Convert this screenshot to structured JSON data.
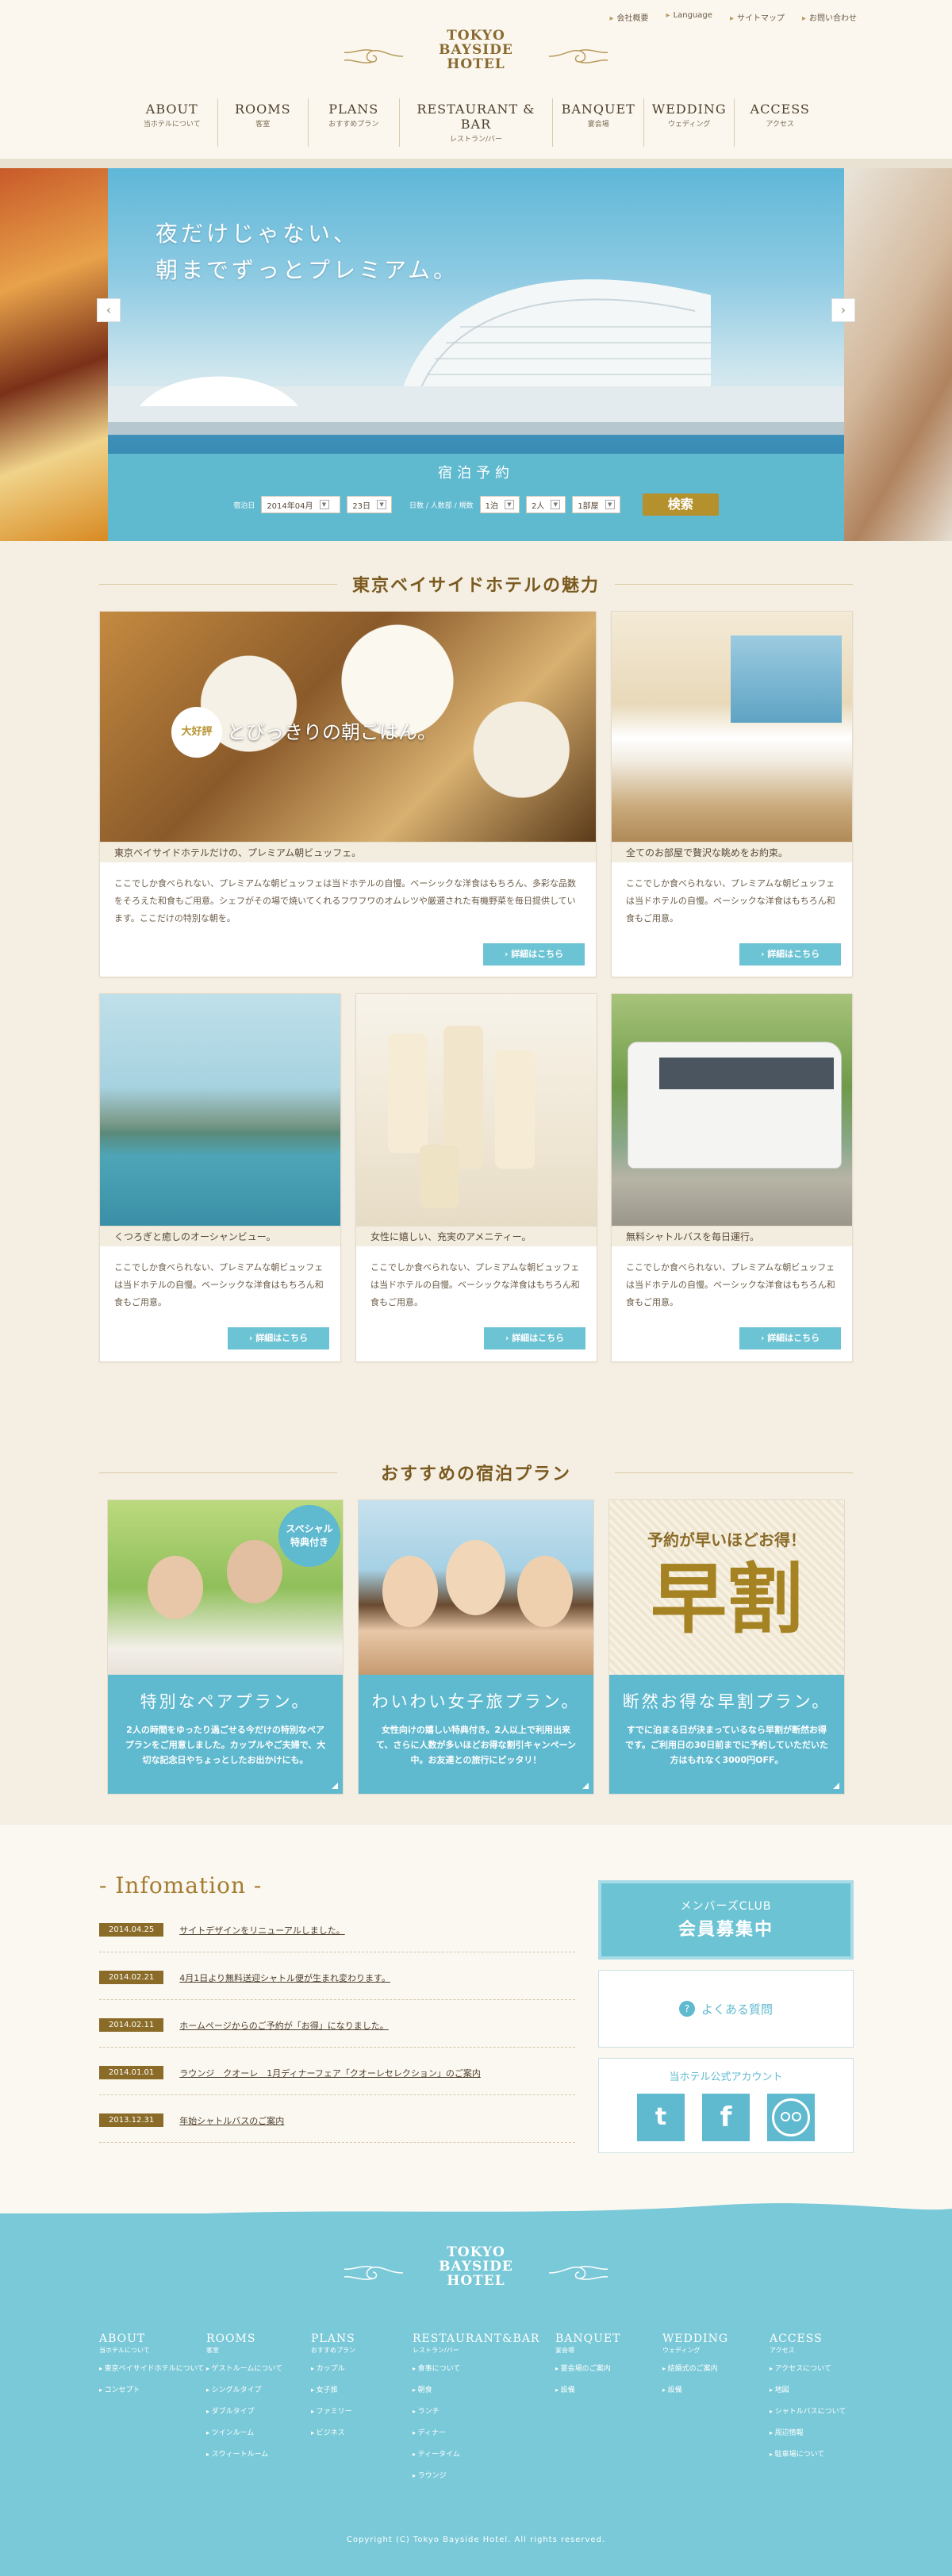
{
  "header": {
    "top_links": [
      "会社概要",
      "Language",
      "サイトマップ",
      "お問い合わせ"
    ],
    "logo_lines": [
      "TOKYO",
      "BAYSIDE",
      "HOTEL"
    ],
    "nav": [
      {
        "en": "ABOUT",
        "ja": "当ホテルについて"
      },
      {
        "en": "ROOMS",
        "ja": "客室"
      },
      {
        "en": "PLANS",
        "ja": "おすすめプラン"
      },
      {
        "en": "RESTAURANT & BAR",
        "ja": "レストラン/バー"
      },
      {
        "en": "BANQUET",
        "ja": "宴会場"
      },
      {
        "en": "WEDDING",
        "ja": "ウェディング"
      },
      {
        "en": "ACCESS",
        "ja": "アクセス"
      }
    ]
  },
  "hero": {
    "copy_line1": "夜だけじゃない、",
    "copy_line2": "朝までずっとプレミアム。",
    "prev_icon": "chevron-left-icon",
    "next_icon": "chevron-right-icon"
  },
  "booking": {
    "title": "宿泊予約",
    "checkin_label": "宿泊日",
    "month_value": "2014年04月",
    "day_value": "23日",
    "nights_label": "日数 / 人数部 / 規数",
    "nights_value": "1泊",
    "people_value": "2人",
    "rooms_value": "1部屋",
    "search_label": "検索"
  },
  "features": {
    "heading": "東京ベイサイドホテルの魅力",
    "badge": "大好評",
    "breakfast_overlay": "とびっきりの朝ごはん。",
    "cards": [
      {
        "caption": "東京ベイサイドホテルだけの、プレミアム朝ビュッフェ。",
        "text": "ここでしか食べられない、プレミアムな朝ビュッフェは当ドホテルの自慢。ベーシックな洋食はもちろん、多彩な品数をそろえた和食もご用意。シェフがその場で焼いてくれるフワフワのオムレツや厳選された有機野菜を毎日提供しています。ここだけの特別な朝を。",
        "button": "詳細はこちら"
      },
      {
        "caption": "全てのお部屋で贅沢な眺めをお約束。",
        "text": "ここでしか食べられない、プレミアムな朝ビュッフェは当ドホテルの自慢。ベーシックな洋食はもちろん和食もご用意。",
        "button": "詳細はこちら"
      },
      {
        "caption": "くつろぎと癒しのオーシャンビュー。",
        "text": "ここでしか食べられない、プレミアムな朝ビュッフェは当ドホテルの自慢。ベーシックな洋食はもちろん和食もご用意。",
        "button": "詳細はこちら"
      },
      {
        "caption": "女性に嬉しい、充実のアメニティー。",
        "text": "ここでしか食べられない、プレミアムな朝ビュッフェは当ドホテルの自慢。ベーシックな洋食はもちろん和食もご用意。",
        "button": "詳細はこちら"
      },
      {
        "caption": "無料シャトルバスを毎日運行。",
        "text": "ここでしか食べられない、プレミアムな朝ビュッフェは当ドホテルの自慢。ベーシックな洋食はもちろん和食もご用意。",
        "button": "詳細はこちら"
      }
    ]
  },
  "plans": {
    "heading": "おすすめの宿泊プラン",
    "special_badge_line1": "スペシャル",
    "special_badge_line2": "特典付き",
    "early_banner": "予約が早いほどお得！",
    "early_big": "早割",
    "items": [
      {
        "title": "特別なペアプラン。",
        "desc": "2人の時間をゆったり過ごせる今だけの特別なペアプランをご用意しました。カップルやご夫婦で、大切な記念日やちょっとしたお出かけにも。"
      },
      {
        "title": "わいわい女子旅プラン。",
        "desc": "女性向けの嬉しい特典付き。2人以上で利用出来て、さらに人数が多いほどお得な割引キャンペーン中。お友達との旅行にピッタリ！"
      },
      {
        "title": "断然お得な早割プラン。",
        "desc": "すでに泊まる日が決まっているなら早割が断然お得です。ご利用日の30日前までに予約していただいた方はもれなく3000円OFF。"
      }
    ]
  },
  "info": {
    "heading": "- Infomation -",
    "news": [
      {
        "date": "2014.04.25",
        "title": "サイトデザインをリニューアルしました。"
      },
      {
        "date": "2014.02.21",
        "title": "4月1日より無料送迎シャトル便が生まれ変わります。"
      },
      {
        "date": "2014.02.11",
        "title": "ホームページからのご予約が「お得」になりました。"
      },
      {
        "date": "2014.01.01",
        "title": "ラウンジ　クオーレ　1月ディナーフェア「クオーレセレクション」のご案内"
      },
      {
        "date": "2013.12.31",
        "title": "年始シャトルバスのご案内"
      }
    ],
    "member_small": "メンバーズCLUB",
    "member_big": "会員募集中",
    "faq": "よくある質問",
    "social_title": "当ホテル公式アカウント"
  },
  "footer": {
    "logo_lines": [
      "TOKYO",
      "BAYSIDE",
      "HOTEL"
    ],
    "cols": [
      {
        "h": "ABOUT",
        "hj": "当ホテルについて",
        "items": [
          "東京ベイサイドホテルについて",
          "コンセプト"
        ]
      },
      {
        "h": "ROOMS",
        "hj": "客室",
        "items": [
          "ゲストルームについて",
          "シングルタイプ",
          "ダブルタイプ",
          "ツインルーム",
          "スウィートルーム"
        ]
      },
      {
        "h": "PLANS",
        "hj": "おすすめプラン",
        "items": [
          "カップル",
          "女子旅",
          "ファミリー",
          "ビジネス"
        ]
      },
      {
        "h": "RESTAURANT&BAR",
        "hj": "レストラン/バー",
        "items": [
          "食事について",
          "朝食",
          "ランチ",
          "ディナー",
          "ティータイム",
          "ラウンジ"
        ]
      },
      {
        "h": "BANQUET",
        "hj": "宴会場",
        "items": [
          "宴会場のご案内",
          "設備"
        ]
      },
      {
        "h": "WEDDING",
        "hj": "ウェディング",
        "items": [
          "結婚式のご案内",
          "設備"
        ]
      },
      {
        "h": "ACCESS",
        "hj": "アクセス",
        "items": [
          "アクセスについて",
          "地図",
          "シャトルバスについて",
          "周辺情報",
          "駐車場について"
        ]
      }
    ],
    "copyright": "Copyright (C) Tokyo Bayside Hotel. All rights reserved."
  },
  "colors": {
    "accent": "#5fb9cf",
    "gold": "#b5912e",
    "bg": "#f5efe3"
  }
}
